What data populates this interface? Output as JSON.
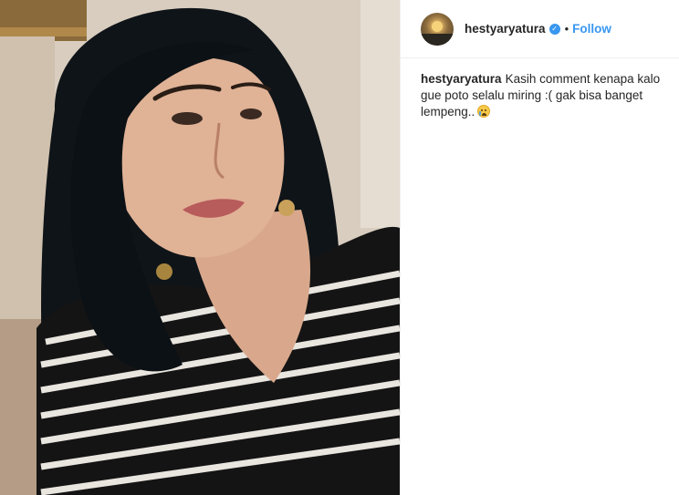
{
  "post": {
    "username": "hestyaryatura",
    "follow_label": "Follow",
    "separator": "•",
    "verified_icon": "verified-badge-icon",
    "caption": {
      "username": "hestyaryatura",
      "text": "Kasih comment kenapa kalo gue poto selalu miring :( gak bisa banget lempeng..",
      "emoji": "loudly-crying-face"
    }
  },
  "colors": {
    "link_blue": "#3897f0",
    "text": "#262626",
    "divider": "#efefef"
  }
}
